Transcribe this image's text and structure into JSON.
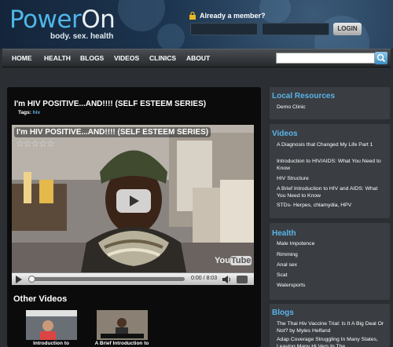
{
  "header": {
    "logo_text_power": "Power",
    "logo_text_on": "On",
    "tagline": "body. sex. health",
    "member_prompt": "Already a member?",
    "login_label": "LOGIN"
  },
  "nav": {
    "items": [
      "HOME",
      "HEALTH",
      "BLOGS",
      "VIDEOS",
      "CLINICS",
      "ABOUT"
    ]
  },
  "main": {
    "title": "I'm HIV POSITIVE...AND!!!! (SELF ESTEEM SERIES)",
    "tags_label": "Tags:",
    "tag": "hiv",
    "player": {
      "title": "I'm HIV POSITIVE...AND!!!! (SELF ESTEEM SERIES)",
      "rating": "☆☆☆☆☆",
      "time": "0:00 / 8:03",
      "progress": 0,
      "yt_you": "You",
      "yt_tube": "Tube"
    },
    "other_videos_heading": "Other Videos",
    "other_videos": [
      "Introduction to",
      "A Brief Introduction to"
    ]
  },
  "sidebar": {
    "local_resources": {
      "heading": "Local Resources",
      "items": [
        "Demo Clinic"
      ]
    },
    "videos": {
      "heading": "Videos",
      "items": [
        "A Diagnosis that Changed My Life Part 1",
        "Introduction to HIV/AIDS: What You Need to Know",
        "HIV Structure",
        "A Brief Introduction to HIV and AIDS: What You Need to Know",
        "STDs- Herpes, chlamydia, HPV"
      ]
    },
    "health": {
      "heading": "Health",
      "items": [
        "Male Impotence",
        "Rimming",
        "Anal sex",
        "Scat",
        "Watersports"
      ]
    },
    "blogs": {
      "heading": "Blogs",
      "items": [
        "The Thai Hiv Vaccine Trial: Is It A Big Deal Or Not? by Myles Helfand",
        "Adap Coverage Struggling In Many States, Leaving Many Hi Vers In The"
      ]
    }
  },
  "colors": {
    "accent": "#5ab3e8",
    "header_bg": "#1d3550",
    "panel_bg": "#3a3e42",
    "main_bg": "#0b0b0b"
  }
}
